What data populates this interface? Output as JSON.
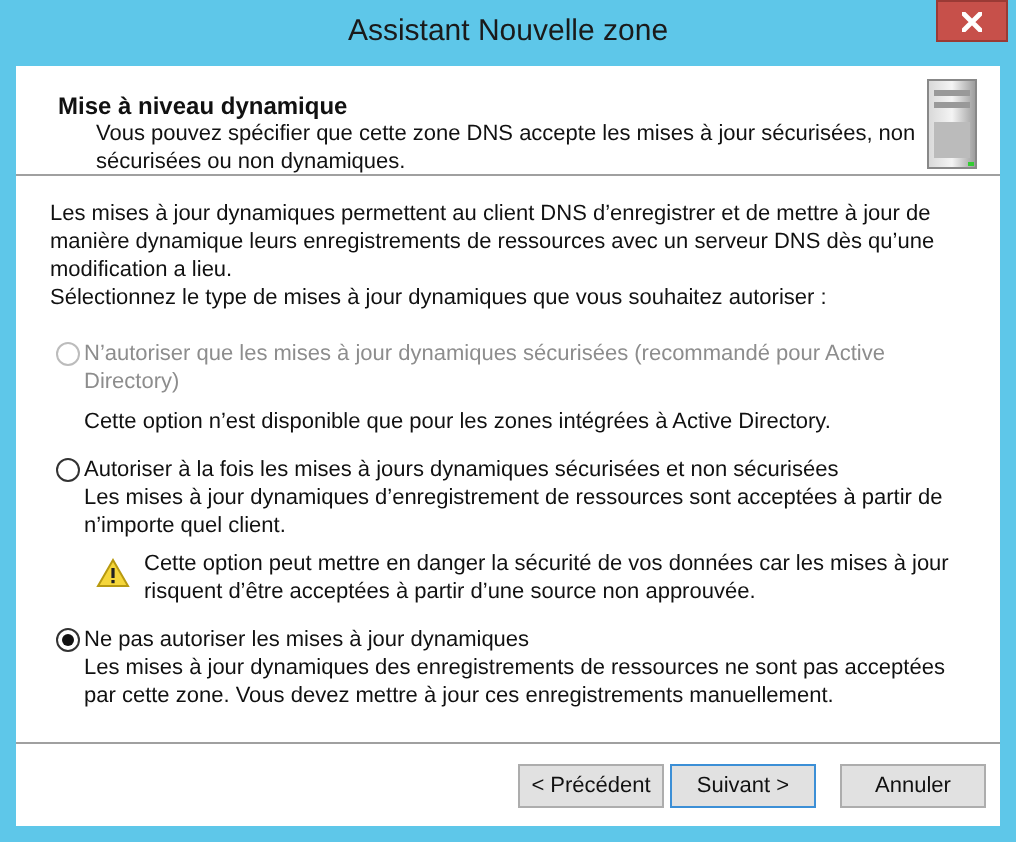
{
  "window": {
    "title": "Assistant Nouvelle zone"
  },
  "header": {
    "title": "Mise à niveau dynamique",
    "subtitle": "Vous pouvez spécifier que cette zone DNS accepte les mises à jour sécurisées, non sécurisées ou non dynamiques."
  },
  "intro": [
    "Les mises à jour dynamiques permettent au client DNS d’enregistrer et de mettre à jour de manière dynamique leurs enregistrements de ressources avec un serveur DNS dès qu’une modification a lieu.",
    "Sélectionnez le type de mises à jour dynamiques que vous souhaitez autoriser :"
  ],
  "options": [
    {
      "label": "N’autoriser que les mises à jour dynamiques sécurisées (recommandé pour Active Directory)",
      "selected": false,
      "disabled": true,
      "description": "Cette option n’est disponible que pour les zones intégrées à Active Directory."
    },
    {
      "label": "Autoriser à la fois les mises à jours dynamiques sécurisées et non sécurisées",
      "selected": false,
      "disabled": false,
      "description": "Les mises à jour dynamiques d’enregistrement de ressources sont acceptées à partir de n’importe quel client.",
      "warning": "Cette option peut mettre en danger la sécurité de vos données car les mises à jour risquent d’être acceptées à partir d’une source non approuvée."
    },
    {
      "label": "Ne pas autoriser les mises à jour dynamiques",
      "selected": true,
      "disabled": false,
      "description": "Les mises à jour dynamiques des enregistrements de ressources ne sont pas acceptées par cette zone. Vous devez mettre à jour ces enregistrements manuellement."
    }
  ],
  "buttons": [
    {
      "label": "< Précédent",
      "default": false
    },
    {
      "label": "Suivant >",
      "default": true
    },
    {
      "label": "Annuler",
      "default": false
    }
  ]
}
